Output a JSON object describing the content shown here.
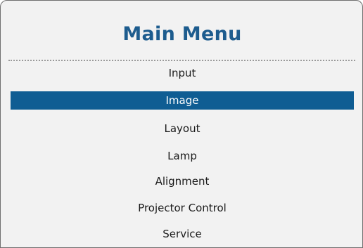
{
  "menu": {
    "title": "Main Menu",
    "items": [
      {
        "label": "Input",
        "selected": false
      },
      {
        "label": "Image",
        "selected": true
      },
      {
        "label": "Layout",
        "selected": false
      },
      {
        "label": "Lamp",
        "selected": false
      },
      {
        "label": "Alignment",
        "selected": false
      },
      {
        "label": "Projector Control",
        "selected": false
      },
      {
        "label": "Service",
        "selected": false
      }
    ]
  },
  "colors": {
    "title": "#1d5c8e",
    "selection_background": "#0f5d93",
    "selection_text": "#ffffff",
    "panel_background": "#f2f2f2",
    "item_text": "#1a1a1a"
  }
}
